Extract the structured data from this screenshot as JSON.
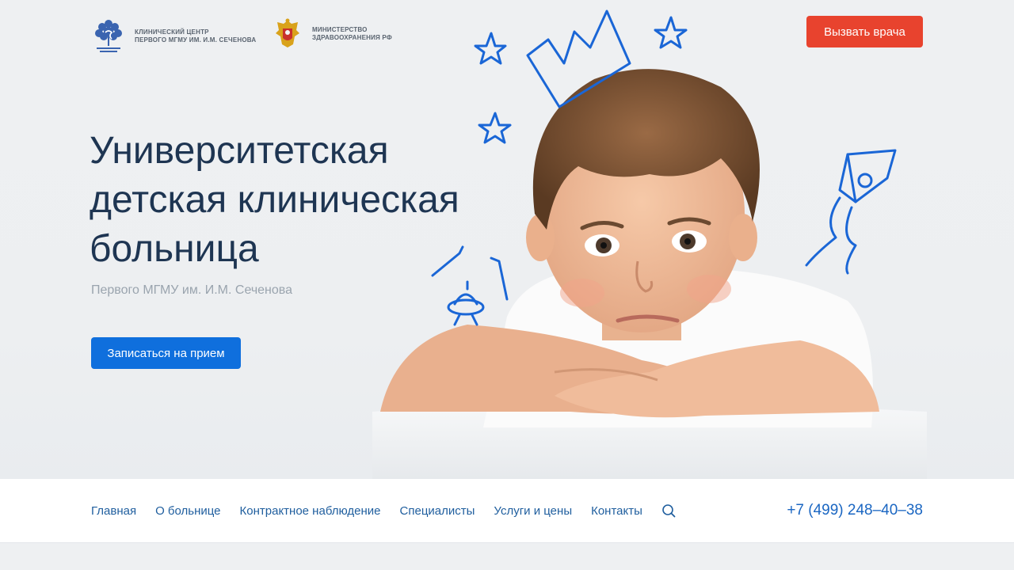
{
  "header": {
    "logo1": {
      "name": "Сеченовский Университет",
      "lines": [
        "КЛИНИЧЕСКИЙ ЦЕНТР",
        "ПЕРВОГО МГМУ ИМ. И.М. СЕЧЕНОВА"
      ]
    },
    "logo2": {
      "lines": [
        "МИНИСТЕРСТВО",
        "ЗДРАВООХРАНЕНИЯ РФ"
      ]
    },
    "call_button": "Вызвать врача"
  },
  "hero": {
    "title_lines": [
      "Университетская",
      "детская клиническая",
      "больница"
    ],
    "subtitle": "Первого МГМУ им. И.М. Сеченова",
    "appointment_button": "Записаться на прием"
  },
  "nav": {
    "items": [
      "Главная",
      "О больнице",
      "Контрактное наблюдение",
      "Специалисты",
      "Услуги и цены",
      "Контакты"
    ],
    "phone": "+7 (499) 248–40–38"
  },
  "colors": {
    "accent_blue": "#0f6fdd",
    "accent_red": "#e8432e",
    "title": "#1e3552",
    "doodle": "#1a66d6"
  }
}
